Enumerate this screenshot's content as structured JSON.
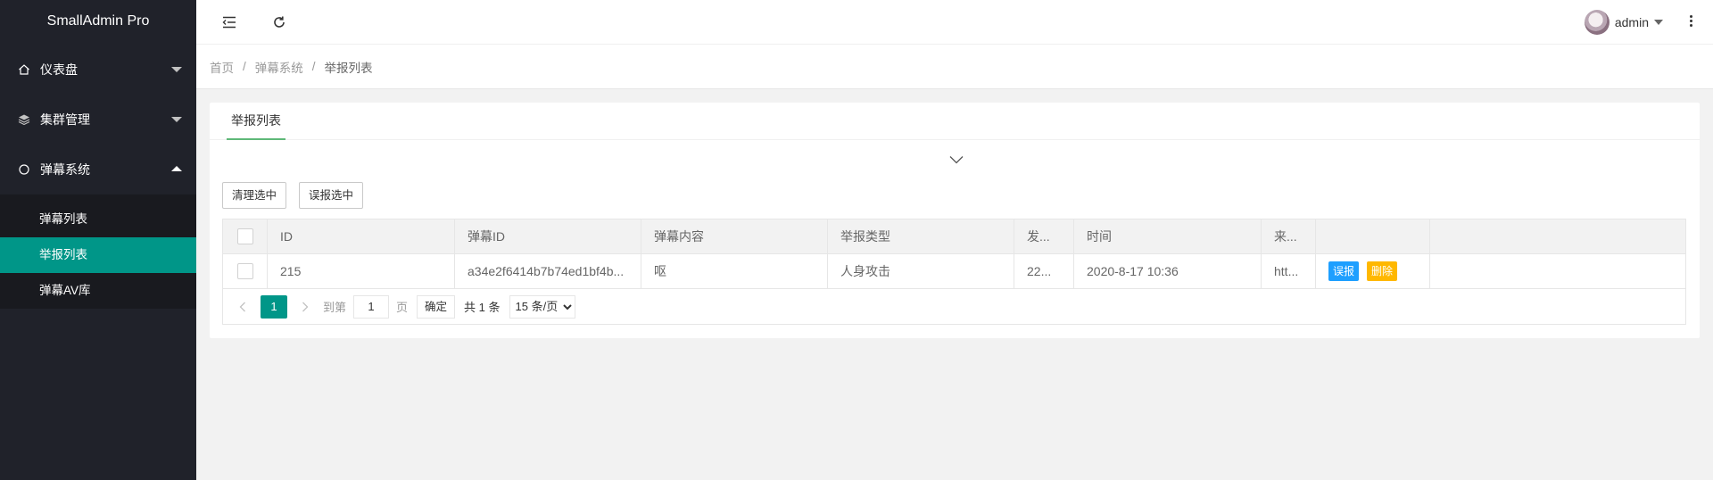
{
  "app": {
    "title": "SmallAdmin Pro"
  },
  "sidebar": {
    "items": [
      {
        "label": "仪表盘",
        "icon": "home-icon",
        "expanded": false
      },
      {
        "label": "集群管理",
        "icon": "layers-icon",
        "expanded": false
      },
      {
        "label": "弹幕系统",
        "icon": "circle-icon",
        "expanded": true
      }
    ],
    "submenu": [
      {
        "label": "弹幕列表",
        "active": false
      },
      {
        "label": "举报列表",
        "active": true
      },
      {
        "label": "弹幕AV库",
        "active": false
      }
    ],
    "accent_color": "#009688"
  },
  "header": {
    "user_name": "admin",
    "icons": [
      "menu-toggle-icon",
      "refresh-icon",
      "more-vertical-icon"
    ]
  },
  "breadcrumb": [
    "首页",
    "弹幕系统",
    "举报列表"
  ],
  "tab": {
    "label": "举报列表"
  },
  "actions": {
    "clear_selected": "清理选中",
    "misreport_selected": "误报选中"
  },
  "table": {
    "columns": [
      "ID",
      "弹幕ID",
      "弹幕内容",
      "举报类型",
      "发...",
      "时间",
      "来..."
    ],
    "rows": [
      {
        "id": "215",
        "danmaku_id": "a34e2f6414b7b74ed1bf4b...",
        "content": "呕",
        "type": "人身攻击",
        "sender": "22...",
        "time": "2020-8-17 10:36",
        "source": "htt...",
        "btn_misreport": "误报",
        "btn_delete": "删除"
      }
    ]
  },
  "pager": {
    "current_page": "1",
    "goto_label": "到第",
    "goto_value": "1",
    "page_unit": "页",
    "confirm": "确定",
    "total": "共 1 条",
    "page_size": "15 条/页"
  }
}
